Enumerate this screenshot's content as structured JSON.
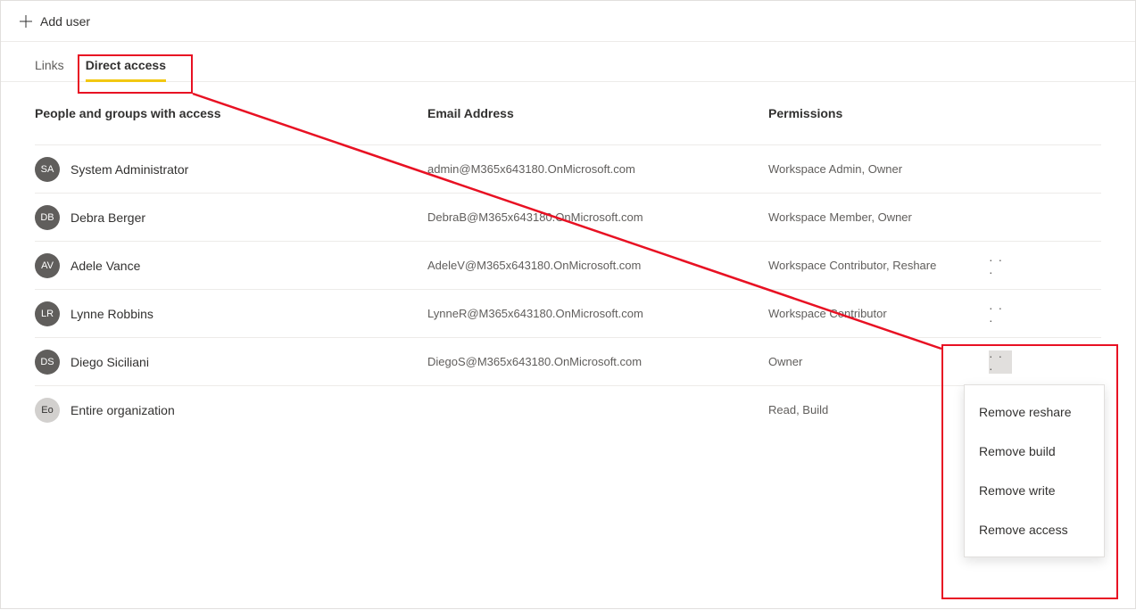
{
  "toolbar": {
    "add_user_label": "Add user"
  },
  "tabs": {
    "links": "Links",
    "direct_access": "Direct access"
  },
  "headers": {
    "people": "People and groups with access",
    "email": "Email Address",
    "permissions": "Permissions"
  },
  "rows": [
    {
      "initials": "SA",
      "name": "System Administrator",
      "email": "admin@M365x643180.OnMicrosoft.com",
      "perm": "Workspace Admin, Owner",
      "actions": false,
      "light": false
    },
    {
      "initials": "DB",
      "name": "Debra Berger",
      "email": "DebraB@M365x643180.OnMicrosoft.com",
      "perm": "Workspace Member, Owner",
      "actions": false,
      "light": false
    },
    {
      "initials": "AV",
      "name": "Adele Vance",
      "email": "AdeleV@M365x643180.OnMicrosoft.com",
      "perm": "Workspace Contributor, Reshare",
      "actions": true,
      "light": false
    },
    {
      "initials": "LR",
      "name": "Lynne Robbins",
      "email": "LynneR@M365x643180.OnMicrosoft.com",
      "perm": "Workspace Contributor",
      "actions": true,
      "light": false
    },
    {
      "initials": "DS",
      "name": "Diego Siciliani",
      "email": "DiegoS@M365x643180.OnMicrosoft.com",
      "perm": "Owner",
      "actions": true,
      "light": false,
      "hovered": true
    },
    {
      "initials": "Eo",
      "name": "Entire organization",
      "email": "",
      "perm": "Read, Build",
      "actions": false,
      "light": true
    }
  ],
  "menu": {
    "items": [
      "Remove reshare",
      "Remove build",
      "Remove write",
      "Remove access"
    ]
  }
}
